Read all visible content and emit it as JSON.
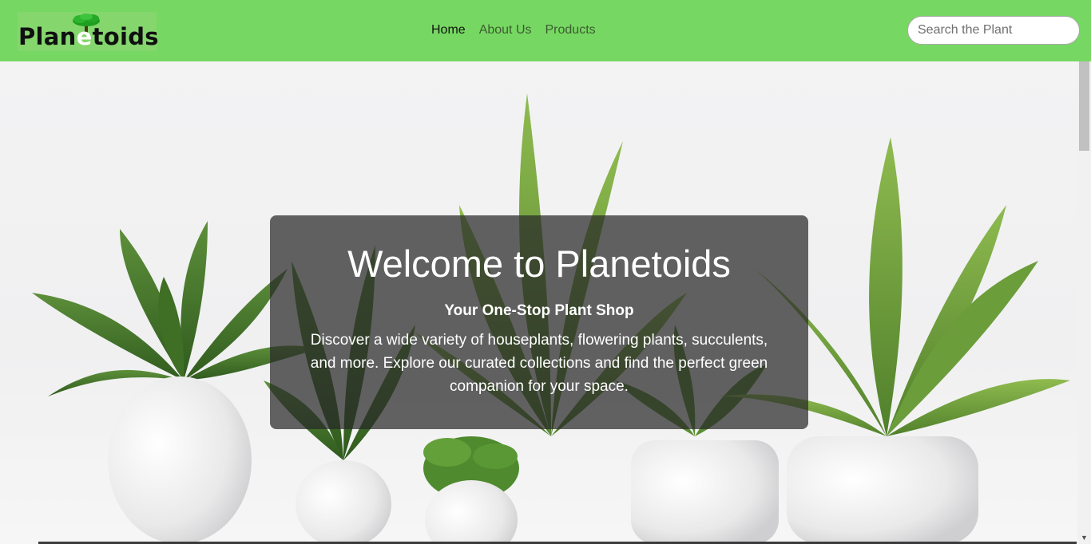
{
  "brand": {
    "name_part1": "Plan",
    "name_highlight": "e",
    "name_part2": "toids"
  },
  "nav": {
    "items": [
      {
        "label": "Home",
        "active": true
      },
      {
        "label": "About Us",
        "active": false
      },
      {
        "label": "Products",
        "active": false
      }
    ]
  },
  "search": {
    "placeholder": "Search the Plant",
    "value": ""
  },
  "hero": {
    "title": "Welcome to Planetoids",
    "subtitle": "Your One-Stop Plant Shop",
    "description": "Discover a wide variety of houseplants, flowering plants, succulents, and more. Explore our curated collections and find the perfect green companion for your space.",
    "background_image": "potted-plants-photo"
  },
  "colors": {
    "navbar": "#76d862",
    "panel": "rgba(40,40,40,0.72)",
    "text_light": "#ffffff"
  },
  "icons": {
    "logo": "tree-icon",
    "scroll_down": "chevron-down-icon"
  }
}
